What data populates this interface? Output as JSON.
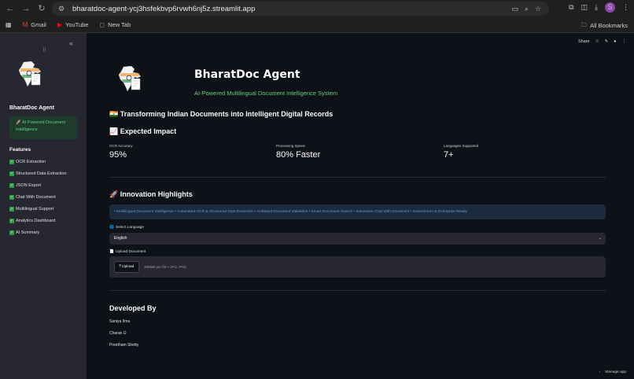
{
  "browser": {
    "url": "bharatdoc-agent-ycj3hsfekbvp6rvwh6nj5z.streamlit.app",
    "avatar_letter": "S",
    "bookmarks": [
      {
        "label": "Gmail",
        "icon": "gmail-icon"
      },
      {
        "label": "YouTube",
        "icon": "youtube-icon"
      },
      {
        "label": "New Tab",
        "icon": "newtab-icon"
      }
    ],
    "all_bookmarks": "All Bookmarks"
  },
  "sidebar": {
    "title": "BharatDoc Agent",
    "badge": "🚀 AI Powered Document Intelligence",
    "features_heading": "Features",
    "features": [
      "OCR Extraction",
      "Structured Data Extraction",
      "JSON Export",
      "Chat With Document",
      "Multilingual Support",
      "Analytics Dashboard",
      "AI Summary"
    ]
  },
  "toolbar": {
    "share": "Share"
  },
  "main": {
    "title": "BharatDoc Agent",
    "subtitle": "AI-Powered Multilingual Document Intelligence System",
    "transform_heading": "🇮🇳 Transforming Indian Documents into Intelligent Digital Records",
    "impact_heading": "📈 Expected Impact",
    "metrics": [
      {
        "label": "OCR Accuracy",
        "value": "95%"
      },
      {
        "label": "Processing Speed",
        "value": "80% Faster"
      },
      {
        "label": "Languages Supported",
        "value": "7+"
      }
    ],
    "innovation_heading": "🚀 Innovation Highlights",
    "highlights": "• Multilingual Document Intelligence • Automated OCR & Structured Data Extraction • AI-Based Document Validation • Smart Document Search • Interactive Chat With Document • Government & Enterprise Ready",
    "language_label": "Select Language",
    "language_value": "English",
    "upload_label": "Upload Document",
    "upload_button": "Upload",
    "upload_hint": "200MB per file • JPG, PNG",
    "developed_heading": "Developed By",
    "developers": [
      "Saniya Ilma",
      "Charan G",
      "Preetham Shetty"
    ],
    "manage_app": "Manage app"
  },
  "colors": {
    "accent_green": "#5fd37a",
    "accent_blue": "#5a9fe0",
    "background": "#0e1117",
    "sidebar": "#262730"
  }
}
